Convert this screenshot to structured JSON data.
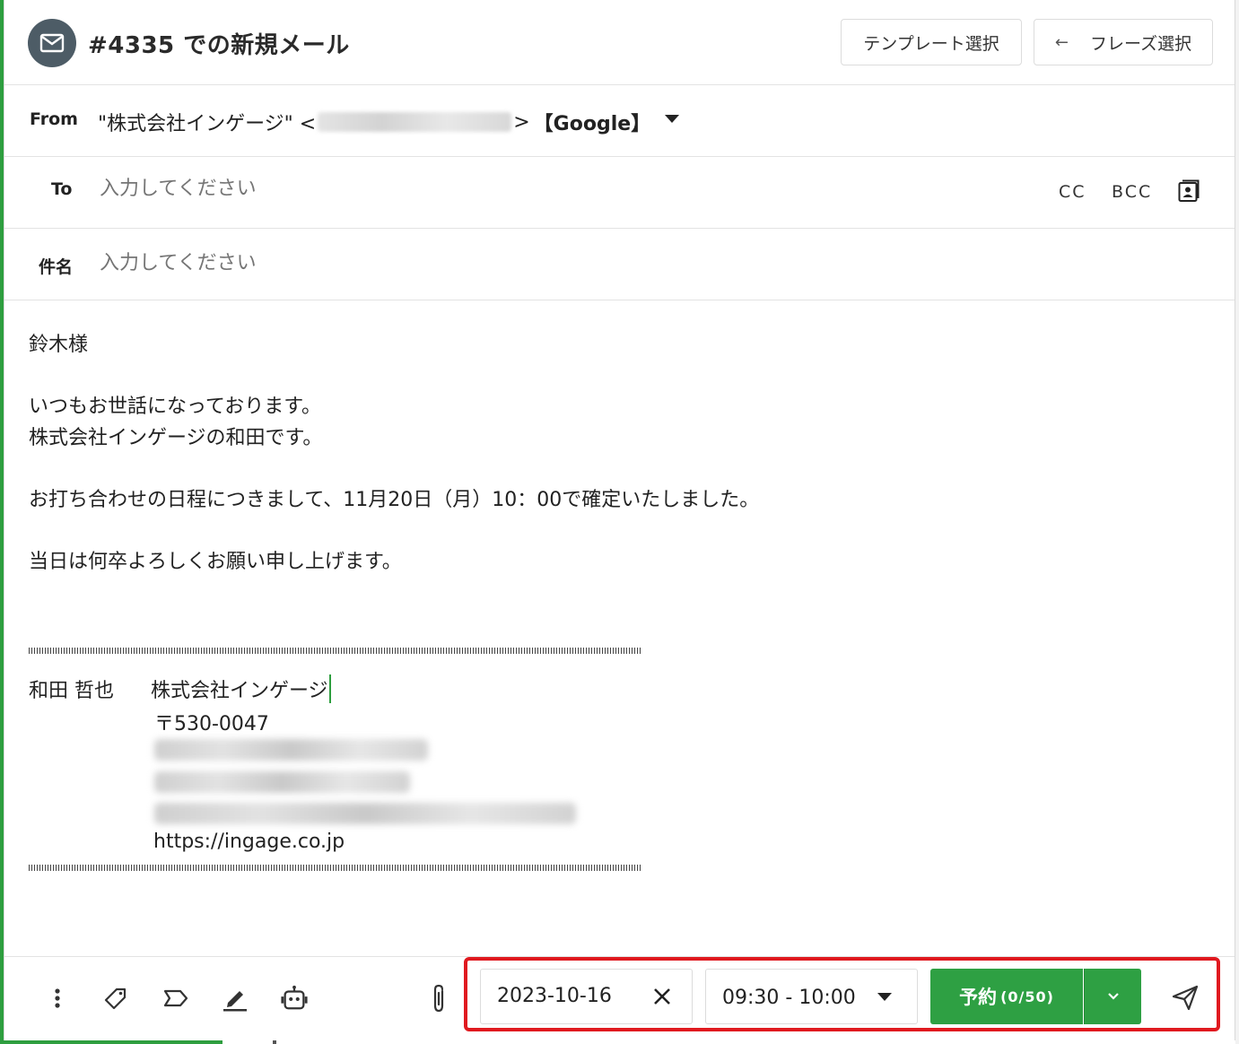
{
  "header": {
    "title": "#4335 での新規メール",
    "template_button": "テンプレート選択",
    "phrase_arrow": "←",
    "phrase_button": "フレーズ選択"
  },
  "from": {
    "label": "From",
    "name_prefix": "\"株式会社インゲージ\" <",
    "name_suffix": ">",
    "provider": "【Google】"
  },
  "to": {
    "label": "To",
    "placeholder": "入力してください",
    "cc": "CC",
    "bcc": "BCC"
  },
  "subject": {
    "label": "件名",
    "placeholder": "入力してください"
  },
  "body": {
    "text": "鈴木様\n\nいつもお世話になっております。\n株式会社インゲージの和田です。\n\nお打ち合わせの日程につきまして、11月20日（月）10：00で確定いたしました。\n\n当日は何卒よろしくお願い申し上げます。",
    "signature": {
      "name": "和田 哲也",
      "company": "株式会社インゲージ",
      "zip": "〒530-0047",
      "url": "https://ingage.co.jp"
    }
  },
  "schedule": {
    "date": "2023-10-16",
    "time": "09:30 - 10:00",
    "reserve_label": "予約",
    "reserve_count": "(0/50)"
  },
  "colors": {
    "accent_green": "#2ea043",
    "highlight_red": "#e0191f",
    "avatar_bg": "#4d5c66"
  },
  "icons": [
    "mail-icon",
    "more-vert-icon",
    "tag-icon",
    "label-icon",
    "pen-icon",
    "bot-icon",
    "paperclip-icon",
    "close-icon",
    "chevron-down-icon",
    "send-icon",
    "contacts-icon"
  ]
}
